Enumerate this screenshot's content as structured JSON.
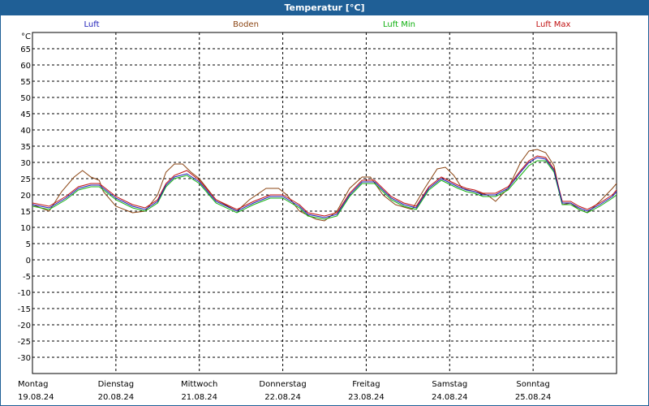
{
  "window": {
    "title": "Temperatur [°C]"
  },
  "chart_data": {
    "type": "line",
    "title": "Temperatur [°C]",
    "ylabel": "°C",
    "ylim": [
      -35,
      70
    ],
    "yticks": [
      65,
      60,
      55,
      50,
      45,
      40,
      35,
      30,
      25,
      20,
      15,
      10,
      5,
      0,
      -5,
      -10,
      -15,
      -20,
      -25,
      -30
    ],
    "xlim": [
      0,
      7
    ],
    "x_axis_unit": "days",
    "grid": true,
    "legend_position": "top",
    "days": [
      {
        "weekday": "Montag",
        "date": "19.08.24"
      },
      {
        "weekday": "Dienstag",
        "date": "20.08.24"
      },
      {
        "weekday": "Mittwoch",
        "date": "21.08.24"
      },
      {
        "weekday": "Donnerstag",
        "date": "22.08.24"
      },
      {
        "weekday": "Freitag",
        "date": "23.08.24"
      },
      {
        "weekday": "Samstag",
        "date": "24.08.24"
      },
      {
        "weekday": "Sonntag",
        "date": "25.08.24"
      }
    ],
    "series": [
      {
        "name": "Luft",
        "color": "#1c1cb8",
        "points": [
          [
            0,
            17
          ],
          [
            0.2,
            16
          ],
          [
            0.4,
            19
          ],
          [
            0.55,
            22
          ],
          [
            0.7,
            23
          ],
          [
            0.8,
            23
          ],
          [
            1.0,
            19
          ],
          [
            1.2,
            16.5
          ],
          [
            1.35,
            15.5
          ],
          [
            1.5,
            18
          ],
          [
            1.6,
            23
          ],
          [
            1.7,
            25.5
          ],
          [
            1.85,
            26.5
          ],
          [
            2.0,
            24
          ],
          [
            2.2,
            18
          ],
          [
            2.45,
            15
          ],
          [
            2.65,
            17.5
          ],
          [
            2.85,
            19.5
          ],
          [
            3.0,
            19.5
          ],
          [
            3.2,
            16.5
          ],
          [
            3.3,
            14
          ],
          [
            3.5,
            13
          ],
          [
            3.65,
            14
          ],
          [
            3.8,
            20
          ],
          [
            3.95,
            24
          ],
          [
            4.1,
            24
          ],
          [
            4.3,
            19
          ],
          [
            4.45,
            17
          ],
          [
            4.6,
            16
          ],
          [
            4.75,
            22
          ],
          [
            4.9,
            25
          ],
          [
            5.1,
            22.5
          ],
          [
            5.2,
            21.5
          ],
          [
            5.3,
            21
          ],
          [
            5.4,
            20
          ],
          [
            5.55,
            20
          ],
          [
            5.7,
            22
          ],
          [
            5.85,
            27
          ],
          [
            5.95,
            30
          ],
          [
            6.05,
            31.5
          ],
          [
            6.15,
            31
          ],
          [
            6.25,
            27.5
          ],
          [
            6.35,
            17.5
          ],
          [
            6.45,
            17.5
          ],
          [
            6.55,
            16
          ],
          [
            6.65,
            15
          ],
          [
            6.8,
            17
          ],
          [
            6.95,
            19.5
          ],
          [
            7.0,
            21
          ],
          [
            7.1,
            20
          ],
          [
            7.2,
            17
          ],
          [
            7.3,
            15.5
          ]
        ]
      },
      {
        "name": "Boden",
        "color": "#8b4513",
        "points": [
          [
            0,
            17
          ],
          [
            0.2,
            15
          ],
          [
            0.35,
            21
          ],
          [
            0.5,
            25.5
          ],
          [
            0.6,
            27.5
          ],
          [
            0.7,
            25.5
          ],
          [
            0.8,
            24.5
          ],
          [
            0.85,
            21
          ],
          [
            1.0,
            16.5
          ],
          [
            1.2,
            14.5
          ],
          [
            1.35,
            15
          ],
          [
            1.5,
            20
          ],
          [
            1.6,
            27
          ],
          [
            1.7,
            29.5
          ],
          [
            1.8,
            29.5
          ],
          [
            1.9,
            27
          ],
          [
            2.0,
            25
          ],
          [
            2.2,
            18.5
          ],
          [
            2.45,
            15
          ],
          [
            2.6,
            18.5
          ],
          [
            2.8,
            22
          ],
          [
            2.95,
            22
          ],
          [
            3.05,
            20
          ],
          [
            3.2,
            15
          ],
          [
            3.4,
            12.5
          ],
          [
            3.5,
            12
          ],
          [
            3.65,
            15
          ],
          [
            3.8,
            22
          ],
          [
            3.95,
            25.5
          ],
          [
            4.05,
            25.5
          ],
          [
            4.2,
            20
          ],
          [
            4.35,
            17
          ],
          [
            4.55,
            15.5
          ],
          [
            4.7,
            22
          ],
          [
            4.85,
            28
          ],
          [
            4.95,
            28.5
          ],
          [
            5.05,
            26
          ],
          [
            5.15,
            22
          ],
          [
            5.3,
            21
          ],
          [
            5.45,
            20
          ],
          [
            5.55,
            18
          ],
          [
            5.7,
            22
          ],
          [
            5.85,
            30
          ],
          [
            5.95,
            33.5
          ],
          [
            6.05,
            34
          ],
          [
            6.15,
            33
          ],
          [
            6.25,
            29
          ],
          [
            6.35,
            17
          ],
          [
            6.45,
            17.5
          ],
          [
            6.55,
            15.5
          ],
          [
            6.65,
            14.5
          ],
          [
            6.8,
            18
          ],
          [
            6.95,
            22
          ],
          [
            7.0,
            23.5
          ],
          [
            7.1,
            21.5
          ],
          [
            7.2,
            17
          ],
          [
            7.3,
            14.5
          ]
        ]
      },
      {
        "name": "Luft Min",
        "color": "#10b010",
        "points": [
          [
            0,
            16.5
          ],
          [
            0.2,
            15.5
          ],
          [
            0.4,
            18.5
          ],
          [
            0.55,
            21.5
          ],
          [
            0.7,
            22.5
          ],
          [
            0.8,
            22.5
          ],
          [
            1.0,
            18.5
          ],
          [
            1.2,
            16
          ],
          [
            1.35,
            15
          ],
          [
            1.5,
            17.5
          ],
          [
            1.6,
            22.5
          ],
          [
            1.7,
            25
          ],
          [
            1.85,
            26
          ],
          [
            2.0,
            23.5
          ],
          [
            2.2,
            17.5
          ],
          [
            2.45,
            14.5
          ],
          [
            2.65,
            17
          ],
          [
            2.85,
            19
          ],
          [
            3.0,
            19
          ],
          [
            3.2,
            16
          ],
          [
            3.3,
            13.5
          ],
          [
            3.5,
            12.5
          ],
          [
            3.65,
            13.5
          ],
          [
            3.8,
            19.5
          ],
          [
            3.95,
            23.5
          ],
          [
            4.1,
            23.5
          ],
          [
            4.3,
            18.5
          ],
          [
            4.45,
            16.5
          ],
          [
            4.6,
            15.5
          ],
          [
            4.75,
            21.5
          ],
          [
            4.9,
            24.5
          ],
          [
            5.1,
            22
          ],
          [
            5.2,
            21
          ],
          [
            5.3,
            20.5
          ],
          [
            5.4,
            19.5
          ],
          [
            5.55,
            19.5
          ],
          [
            5.7,
            21.5
          ],
          [
            5.85,
            26
          ],
          [
            5.95,
            29
          ],
          [
            6.05,
            30.5
          ],
          [
            6.15,
            30.5
          ],
          [
            6.25,
            27
          ],
          [
            6.35,
            17
          ],
          [
            6.45,
            17
          ],
          [
            6.55,
            15.5
          ],
          [
            6.65,
            14.5
          ],
          [
            6.8,
            16.5
          ],
          [
            6.95,
            19
          ],
          [
            7.0,
            20
          ],
          [
            7.1,
            19.5
          ],
          [
            7.2,
            16.5
          ],
          [
            7.3,
            15
          ]
        ]
      },
      {
        "name": "Luft Max",
        "color": "#c01010",
        "points": [
          [
            0,
            17.5
          ],
          [
            0.2,
            16.5
          ],
          [
            0.4,
            19.5
          ],
          [
            0.55,
            22.5
          ],
          [
            0.7,
            23.5
          ],
          [
            0.8,
            23.5
          ],
          [
            1.0,
            19.5
          ],
          [
            1.2,
            17
          ],
          [
            1.35,
            16
          ],
          [
            1.5,
            18.5
          ],
          [
            1.6,
            23.5
          ],
          [
            1.7,
            26
          ],
          [
            1.85,
            27.5
          ],
          [
            2.0,
            24.5
          ],
          [
            2.2,
            18.5
          ],
          [
            2.45,
            15.5
          ],
          [
            2.65,
            18
          ],
          [
            2.85,
            20
          ],
          [
            3.0,
            20
          ],
          [
            3.2,
            17
          ],
          [
            3.3,
            14.5
          ],
          [
            3.5,
            13.5
          ],
          [
            3.65,
            14.5
          ],
          [
            3.8,
            20.5
          ],
          [
            3.95,
            24.5
          ],
          [
            4.1,
            24.5
          ],
          [
            4.3,
            19.5
          ],
          [
            4.45,
            17.5
          ],
          [
            4.6,
            16.5
          ],
          [
            4.75,
            22.5
          ],
          [
            4.9,
            25.5
          ],
          [
            5.1,
            23
          ],
          [
            5.2,
            22
          ],
          [
            5.3,
            21.5
          ],
          [
            5.4,
            20.5
          ],
          [
            5.55,
            20.5
          ],
          [
            5.7,
            22.5
          ],
          [
            5.85,
            27.5
          ],
          [
            5.95,
            30.5
          ],
          [
            6.05,
            32
          ],
          [
            6.15,
            31.5
          ],
          [
            6.25,
            28
          ],
          [
            6.35,
            18
          ],
          [
            6.45,
            18
          ],
          [
            6.55,
            16.5
          ],
          [
            6.65,
            15.5
          ],
          [
            6.8,
            17.5
          ],
          [
            6.95,
            20
          ],
          [
            7.0,
            21.5
          ],
          [
            7.1,
            20.5
          ],
          [
            7.2,
            17.5
          ],
          [
            7.3,
            16
          ]
        ]
      }
    ]
  }
}
